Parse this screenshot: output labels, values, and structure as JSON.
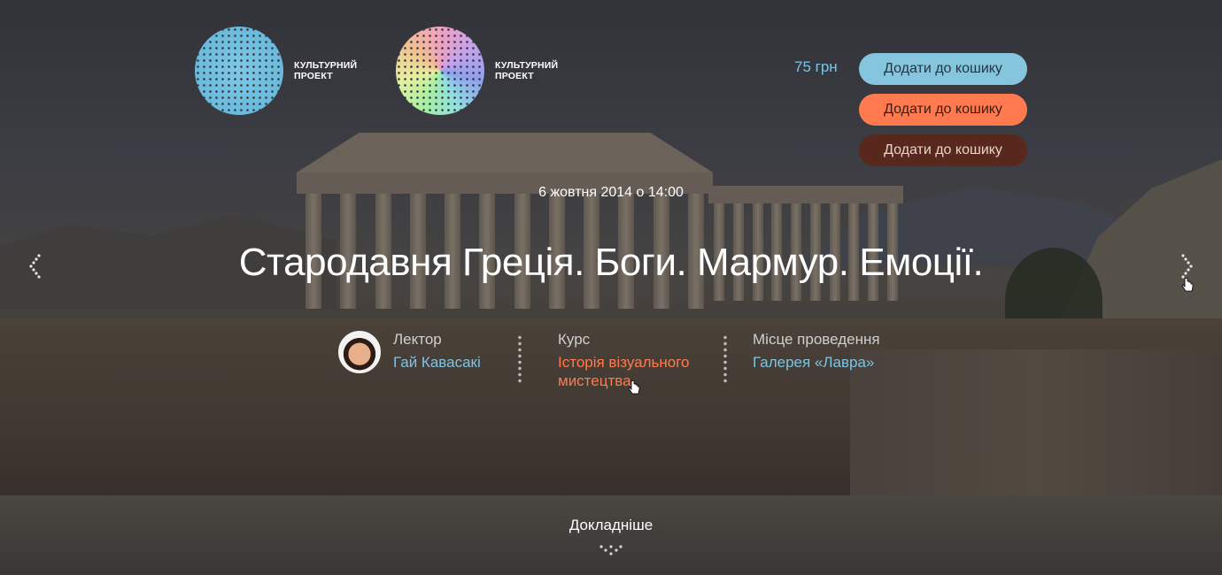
{
  "logos": [
    {
      "line1": "КУЛЬТУРНИЙ",
      "line2": "ПРОЕКТ"
    },
    {
      "line1": "КУЛЬТУРНИЙ",
      "line2": "ПРОЕКТ"
    }
  ],
  "price": "75 грн",
  "cart_buttons": [
    {
      "label": "Додати до кошику",
      "color": "#86c5de"
    },
    {
      "label": "Додати до кошику",
      "color": "#ff7b4f"
    },
    {
      "label": "Додати до кошику",
      "color": "#58281c"
    }
  ],
  "event": {
    "date": "6 жовтня 2014 о 14:00",
    "title": "Стародавня Греція. Боги. Мармур. Емоції."
  },
  "meta": {
    "lecturer_label": "Лектор",
    "lecturer_name": "Гай Кавасакі",
    "course_label": "Курс",
    "course_name": "Історія візуального мистецтва",
    "venue_label": "Місце проведення",
    "venue_name": "Галерея «Лавра»"
  },
  "more_label": "Докладніше",
  "icons": {
    "prev": "chevron-left-icon",
    "next": "chevron-right-icon",
    "more": "chevron-down-icon"
  },
  "colors": {
    "accent_blue": "#7ec4e4",
    "accent_orange": "#ff7b4f",
    "accent_brown": "#58281c"
  }
}
